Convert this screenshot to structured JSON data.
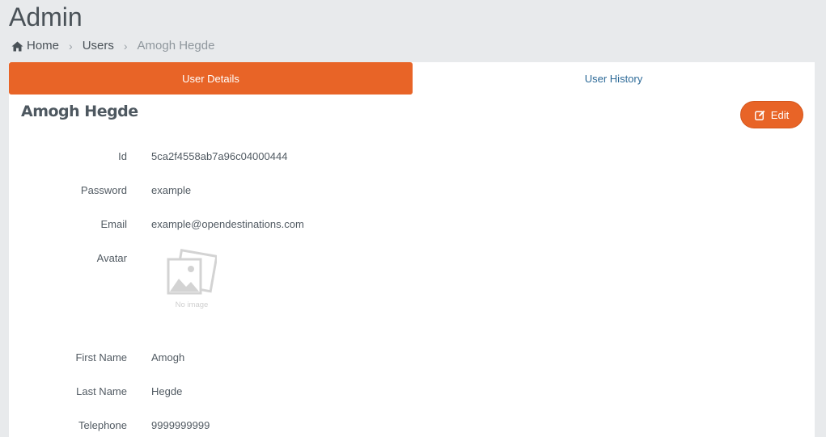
{
  "header": {
    "title": "Admin",
    "breadcrumb": {
      "home": "Home",
      "users": "Users",
      "current": "Amogh Hegde"
    }
  },
  "tabs": [
    {
      "label": "User Details",
      "active": true
    },
    {
      "label": "User History",
      "active": false
    }
  ],
  "details": {
    "name": "Amogh Hegde",
    "edit_label": "Edit",
    "fields": {
      "id": {
        "label": "Id",
        "value": "5ca2f4558ab7a96c04000444"
      },
      "password": {
        "label": "Password",
        "value": "example"
      },
      "email": {
        "label": "Email",
        "value": "example@opendestinations.com"
      },
      "avatar": {
        "label": "Avatar",
        "placeholder_text": "No image"
      },
      "first_name": {
        "label": "First Name",
        "value": "Amogh"
      },
      "last_name": {
        "label": "Last Name",
        "value": "Hegde"
      },
      "telephone": {
        "label": "Telephone",
        "value": "9999999999"
      }
    }
  },
  "colors": {
    "accent": "#e86427",
    "link": "#2d6a98",
    "background": "#e8eaec"
  },
  "icons": {
    "home": "home-icon",
    "edit": "edit-icon",
    "avatar_placeholder": "image-placeholder-icon"
  }
}
